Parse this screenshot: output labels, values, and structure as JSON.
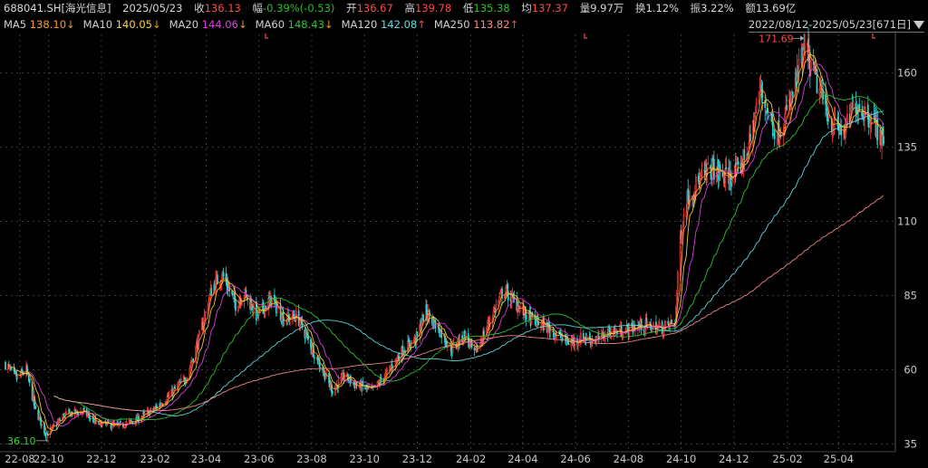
{
  "quote": {
    "symbol": "688041.SH[海光信息]",
    "date": "2025/05/23",
    "close_label": "收",
    "close": "136.13",
    "change_label": "幅",
    "change": "-0.39%(-0.53)",
    "open_label": "开",
    "open": "136.67",
    "high_label": "高",
    "high": "139.78",
    "low_label": "低",
    "low": "135.38",
    "avg_label": "均",
    "avg": "137.37",
    "volume_label": "量",
    "volume": "9.97万",
    "turnover_label": "换",
    "turnover": "1.12%",
    "amplitude_label": "振",
    "amplitude": "3.22%",
    "amount_label": "额",
    "amount": "13.69亿"
  },
  "ma_row": [
    {
      "name": "MA5",
      "value": "138.10",
      "arrow": "↓",
      "color": "#ff9a2a"
    },
    {
      "name": "MA10",
      "value": "140.05",
      "arrow": "↓",
      "color": "#ffd23a"
    },
    {
      "name": "MA20",
      "value": "144.06",
      "arrow": "↓",
      "color": "#e040e0"
    },
    {
      "name": "MA60",
      "value": "148.43",
      "arrow": "↓",
      "color": "#2ec82e"
    },
    {
      "name": "MA120",
      "value": "142.08",
      "arrow": "↑",
      "color": "#5ee0e0"
    },
    {
      "name": "MA250",
      "value": "113.82",
      "arrow": "↑",
      "color": "#ff8888"
    }
  ],
  "range_label": "2022/08/12-2025/05/23[671日]",
  "colors": {
    "up": "#ff3b3b",
    "down": "#2fd9d9",
    "background": "#000000",
    "grid": "#3a3a3a"
  },
  "chart_data": {
    "type": "candlestick",
    "x_ticks": [
      "22-08",
      "22-10",
      "22-12",
      "23-02",
      "23-04",
      "23-06",
      "23-08",
      "23-10",
      "23-12",
      "24-02",
      "24-04",
      "24-06",
      "24-08",
      "24-10",
      "24-12",
      "25-02",
      "25-04"
    ],
    "y_ticks": [
      35,
      60,
      85,
      110,
      135,
      160
    ],
    "ylim": [
      33,
      173
    ],
    "xlim": [
      "2022-08-12",
      "2025-05-23"
    ],
    "grid": true,
    "annotations": {
      "max_label": "171.69",
      "min_label": "36.10",
      "max_value": 171.69,
      "min_value": 36.1
    },
    "close_anchors": [
      [
        "2022-08-12",
        62
      ],
      [
        "2022-08-25",
        57
      ],
      [
        "2022-09-05",
        60
      ],
      [
        "2022-09-15",
        47
      ],
      [
        "2022-09-28",
        38
      ],
      [
        "2022-10-20",
        45
      ],
      [
        "2022-11-10",
        46
      ],
      [
        "2022-11-25",
        42
      ],
      [
        "2022-12-20",
        41
      ],
      [
        "2023-01-10",
        43
      ],
      [
        "2023-02-01",
        47
      ],
      [
        "2023-02-20",
        52
      ],
      [
        "2023-03-10",
        58
      ],
      [
        "2023-03-25",
        72
      ],
      [
        "2023-04-08",
        88
      ],
      [
        "2023-04-20",
        92
      ],
      [
        "2023-05-05",
        82
      ],
      [
        "2023-05-15",
        86
      ],
      [
        "2023-05-30",
        78
      ],
      [
        "2023-06-15",
        84
      ],
      [
        "2023-06-30",
        77
      ],
      [
        "2023-07-15",
        78
      ],
      [
        "2023-07-28",
        70
      ],
      [
        "2023-08-10",
        62
      ],
      [
        "2023-08-25",
        53
      ],
      [
        "2023-09-08",
        58
      ],
      [
        "2023-09-20",
        55
      ],
      [
        "2023-10-10",
        53
      ],
      [
        "2023-10-25",
        58
      ],
      [
        "2023-11-15",
        67
      ],
      [
        "2023-12-01",
        71
      ],
      [
        "2023-12-10",
        80
      ],
      [
        "2023-12-25",
        74
      ],
      [
        "2024-01-10",
        67
      ],
      [
        "2024-01-25",
        72
      ],
      [
        "2024-02-05",
        65
      ],
      [
        "2024-02-25",
        78
      ],
      [
        "2024-03-10",
        87
      ],
      [
        "2024-03-25",
        82
      ],
      [
        "2024-04-10",
        77
      ],
      [
        "2024-04-25",
        75
      ],
      [
        "2024-05-10",
        72
      ],
      [
        "2024-05-25",
        69
      ],
      [
        "2024-06-10",
        71
      ],
      [
        "2024-06-25",
        70
      ],
      [
        "2024-07-10",
        73
      ],
      [
        "2024-07-25",
        73
      ],
      [
        "2024-08-15",
        75
      ],
      [
        "2024-09-10",
        74
      ],
      [
        "2024-09-24",
        76
      ],
      [
        "2024-09-30",
        105
      ],
      [
        "2024-10-08",
        118
      ],
      [
        "2024-10-20",
        123
      ],
      [
        "2024-11-05",
        128
      ],
      [
        "2024-11-20",
        125
      ],
      [
        "2024-12-05",
        126
      ],
      [
        "2024-12-20",
        137
      ],
      [
        "2024-12-31",
        155
      ],
      [
        "2025-01-10",
        146
      ],
      [
        "2025-01-20",
        139
      ],
      [
        "2025-02-05",
        150
      ],
      [
        "2025-02-15",
        162
      ],
      [
        "2025-02-22",
        168
      ],
      [
        "2025-03-05",
        158
      ],
      [
        "2025-03-15",
        150
      ],
      [
        "2025-03-25",
        143
      ],
      [
        "2025-04-08",
        140
      ],
      [
        "2025-04-20",
        150
      ],
      [
        "2025-05-05",
        146
      ],
      [
        "2025-05-15",
        142
      ],
      [
        "2025-05-23",
        136.13
      ]
    ],
    "moving_averages": [
      5,
      10,
      20,
      60,
      120,
      250
    ]
  }
}
